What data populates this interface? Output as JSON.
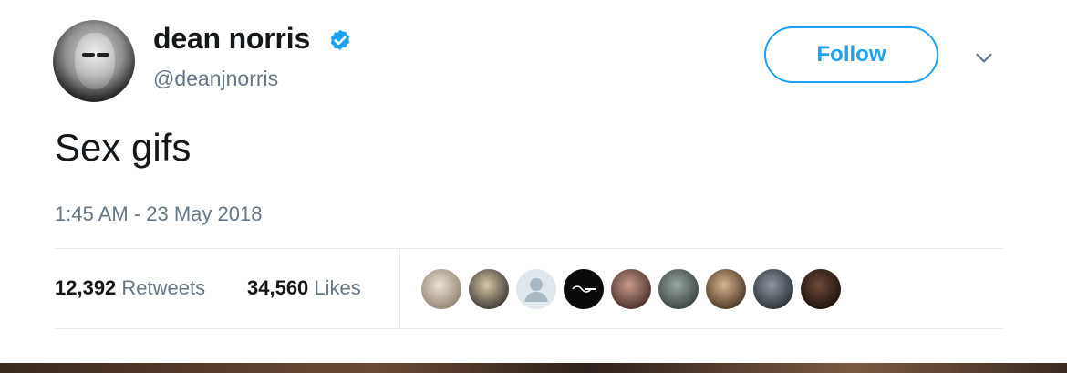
{
  "author": {
    "display_name": "dean norris",
    "handle": "@deanjnorris",
    "verified": true
  },
  "actions": {
    "follow_label": "Follow"
  },
  "tweet": {
    "text": "Sex gifs",
    "timestamp": "1:45 AM - 23 May 2018"
  },
  "stats": {
    "retweets_count": "12,392",
    "retweets_label": "Retweets",
    "likes_count": "34,560",
    "likes_label": "Likes"
  },
  "likers": [
    {
      "kind": "photo",
      "colors": [
        "#e9e2d6",
        "#8a7a68"
      ]
    },
    {
      "kind": "photo",
      "colors": [
        "#d8c7a6",
        "#2b2b2b"
      ]
    },
    {
      "kind": "default-avatar",
      "colors": [
        "#e1e8ed",
        "#aab8c2"
      ]
    },
    {
      "kind": "logo",
      "colors": [
        "#0a0a0a",
        "#ffffff"
      ]
    },
    {
      "kind": "photo",
      "colors": [
        "#c89a8c",
        "#3a2622"
      ]
    },
    {
      "kind": "photo",
      "colors": [
        "#9aa6a0",
        "#2f3a33"
      ]
    },
    {
      "kind": "photo",
      "colors": [
        "#d8b68c",
        "#3b2a1c"
      ]
    },
    {
      "kind": "photo",
      "colors": [
        "#8c96a0",
        "#22272c"
      ]
    },
    {
      "kind": "photo",
      "colors": [
        "#6b4a3a",
        "#140c08"
      ]
    }
  ],
  "colors": {
    "accent": "#1da1f2",
    "text_primary": "#14171a",
    "text_secondary": "#657786",
    "divider": "#e6ecf0"
  }
}
